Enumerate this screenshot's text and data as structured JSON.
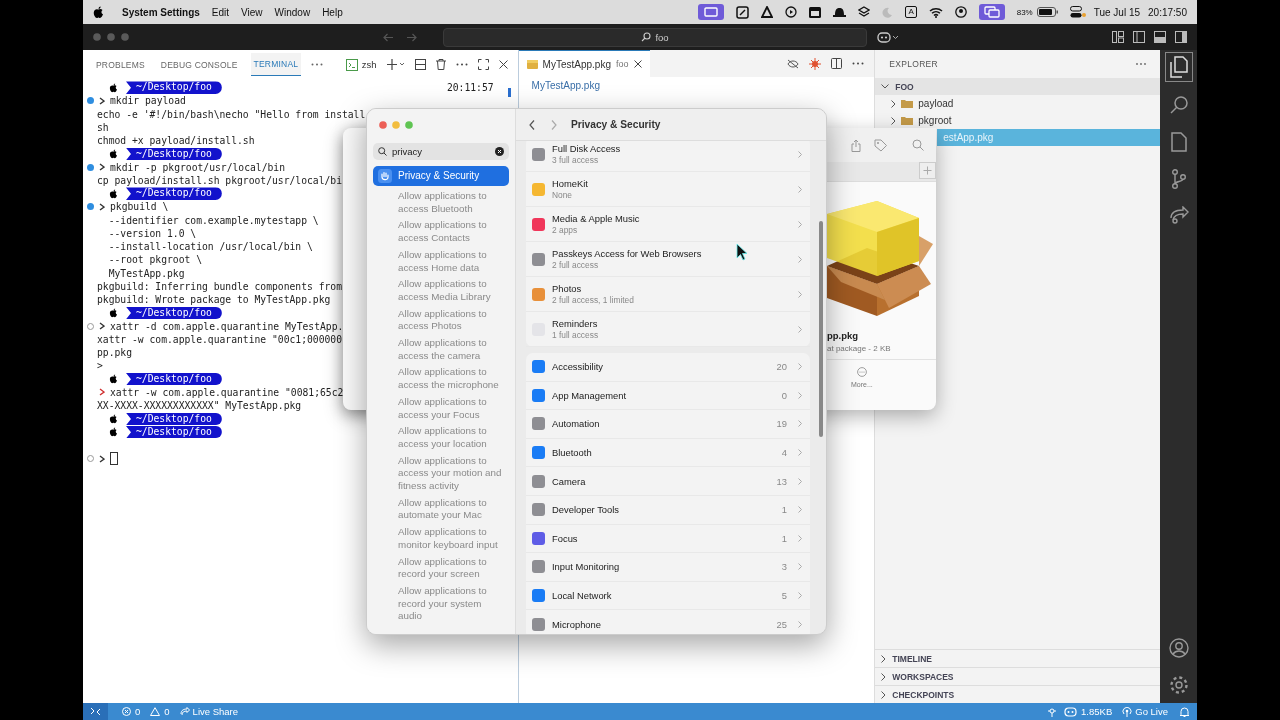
{
  "menu_bar": {
    "app": "System Settings",
    "menus": [
      "Edit",
      "View",
      "Window",
      "Help"
    ],
    "input_source": "A",
    "battery": "83%",
    "date": "Tue Jul 15",
    "time": "20:17:50"
  },
  "vscode": {
    "search": "foo",
    "panel_tabs": [
      {
        "label": "PROBLEMS",
        "selected": false
      },
      {
        "label": "DEBUG CONSOLE",
        "selected": false
      },
      {
        "label": "TERMINAL",
        "selected": true
      }
    ],
    "terminal_name": "zsh",
    "terminal_lines": [
      {
        "kind": "prompt",
        "path": "~/Desktop/foo",
        "clock": "20:11:57"
      },
      {
        "kind": "command",
        "success": true,
        "error": false,
        "text": "mkdir payload"
      },
      {
        "kind": "output",
        "text": "echo -e '#!/bin/bash\\necho \"Hello from install"
      },
      {
        "kind": "output",
        "text": "sh"
      },
      {
        "kind": "output",
        "text": "chmod +x payload/install.sh"
      },
      {
        "kind": "prompt",
        "path": "~/Desktop/foo"
      },
      {
        "kind": "command",
        "success": true,
        "error": false,
        "text": "mkdir -p pkgroot/usr/local/bin"
      },
      {
        "kind": "output",
        "text": "cp payload/install.sh pkgroot/usr/local/bi"
      },
      {
        "kind": "prompt",
        "path": "~/Desktop/foo"
      },
      {
        "kind": "command",
        "success": true,
        "error": false,
        "text": "pkgbuild \\"
      },
      {
        "kind": "output",
        "text": "  --identifier com.example.mytestapp \\"
      },
      {
        "kind": "output",
        "text": "  --version 1.0 \\"
      },
      {
        "kind": "output",
        "text": "  --install-location /usr/local/bin \\"
      },
      {
        "kind": "output",
        "text": "  --root pkgroot \\"
      },
      {
        "kind": "output",
        "text": "  MyTestApp.pkg"
      },
      {
        "kind": "output",
        "text": "pkgbuild: Inferring bundle components from"
      },
      {
        "kind": "output",
        "text": "pkgbuild: Wrote package to MyTestApp.pkg"
      },
      {
        "kind": "prompt",
        "path": "~/Desktop/foo"
      },
      {
        "kind": "command",
        "success": false,
        "error": false,
        "text": "xattr -d com.apple.quarantine MyTestApp."
      },
      {
        "kind": "output",
        "text": "xattr -w com.apple.quarantine \"00c1;000000"
      },
      {
        "kind": "output",
        "text": "pp.pkg"
      },
      {
        "kind": "output",
        "text": ">"
      },
      {
        "kind": "prompt",
        "path": "~/Desktop/foo"
      },
      {
        "kind": "command",
        "error": true,
        "text": "xattr -w com.apple.quarantine \"0081;65c2"
      },
      {
        "kind": "output",
        "text": "XX-XXXX-XXXXXXXXXXXX\" MyTestApp.pkg"
      },
      {
        "kind": "prompt",
        "path": "~/Desktop/foo"
      },
      {
        "kind": "prompt",
        "path": "~/Desktop/foo"
      },
      {
        "kind": "blank"
      },
      {
        "kind": "input",
        "success": false,
        "error": false
      }
    ],
    "editor_tab": {
      "label": "MyTestApp.pkg",
      "folder": "foo"
    },
    "breadcrumb": "MyTestApp.pkg",
    "explorer": {
      "title": "EXPLORER",
      "root": "FOO",
      "items": [
        {
          "label": "payload",
          "kind": "folder",
          "selected": false
        },
        {
          "label": "pkgroot",
          "kind": "folder",
          "selected": false
        },
        {
          "label": "estApp.pkg",
          "kind": "file",
          "selected": true
        }
      ],
      "sections": [
        "TIMELINE",
        "WORKSPACES",
        "CHECKPOINTS"
      ]
    },
    "status_bar": {
      "errors": "0",
      "warnings": "0",
      "live_share": "Live Share",
      "size": "1.85KB",
      "go_live": "Go Live"
    }
  },
  "settings": {
    "search": "privacy",
    "results": [
      {
        "label": "Privacy & Security",
        "selected": true
      },
      {
        "label": "Allow applications to access Bluetooth",
        "selected": false
      },
      {
        "label": "Allow applications to access Contacts",
        "selected": false
      },
      {
        "label": "Allow applications to access Home data",
        "selected": false
      },
      {
        "label": "Allow applications to access Media Library",
        "selected": false
      },
      {
        "label": "Allow applications to access Photos",
        "selected": false
      },
      {
        "label": "Allow applications to access the camera",
        "selected": false
      },
      {
        "label": "Allow applications to access the microphone",
        "selected": false
      },
      {
        "label": "Allow applications to access your Focus",
        "selected": false
      },
      {
        "label": "Allow applications to access your location",
        "selected": false
      },
      {
        "label": "Allow applications to access your motion and fitness activity",
        "selected": false
      },
      {
        "label": "Allow applications to automate your Mac",
        "selected": false
      },
      {
        "label": "Allow applications to monitor keyboard input",
        "selected": false
      },
      {
        "label": "Allow applications to record your screen",
        "selected": false
      },
      {
        "label": "Allow applications to record your system audio",
        "selected": false
      }
    ],
    "title": "Privacy & Security",
    "detail_rows": [
      {
        "name": "Full Disk Access",
        "detail": "3 full access",
        "color": "#8e8e93"
      },
      {
        "name": "HomeKit",
        "detail": "None",
        "color": "#f5b731"
      },
      {
        "name": "Media & Apple Music",
        "detail": "2 apps",
        "color": "#f0365a"
      },
      {
        "name": "Passkeys Access for Web Browsers",
        "detail": "2 full access",
        "color": "#8e8e93"
      },
      {
        "name": "Photos",
        "detail": "2 full access, 1 limited",
        "color": "#e8903a"
      },
      {
        "name": "Reminders",
        "detail": "1 full access",
        "color": "#e4e4e8"
      }
    ],
    "count_rows": [
      {
        "name": "Accessibility",
        "count": "20",
        "color": "#1a7cf5"
      },
      {
        "name": "App Management",
        "count": "0",
        "color": "#1a7cf5"
      },
      {
        "name": "Automation",
        "count": "19",
        "color": "#8e8e93"
      },
      {
        "name": "Bluetooth",
        "count": "4",
        "color": "#1a7cf5"
      },
      {
        "name": "Camera",
        "count": "13",
        "color": "#8e8e93"
      },
      {
        "name": "Developer Tools",
        "count": "1",
        "color": "#8e8e93"
      },
      {
        "name": "Focus",
        "count": "1",
        "color": "#5e5ce6"
      },
      {
        "name": "Input Monitoring",
        "count": "3",
        "color": "#8e8e93"
      },
      {
        "name": "Local Network",
        "count": "5",
        "color": "#1a7cf5"
      },
      {
        "name": "Microphone",
        "count": "25",
        "color": "#8e8e93"
      }
    ]
  },
  "quick_look": {
    "name": "pp.pkg",
    "info": "at package - 2 KB",
    "more": "More..."
  }
}
